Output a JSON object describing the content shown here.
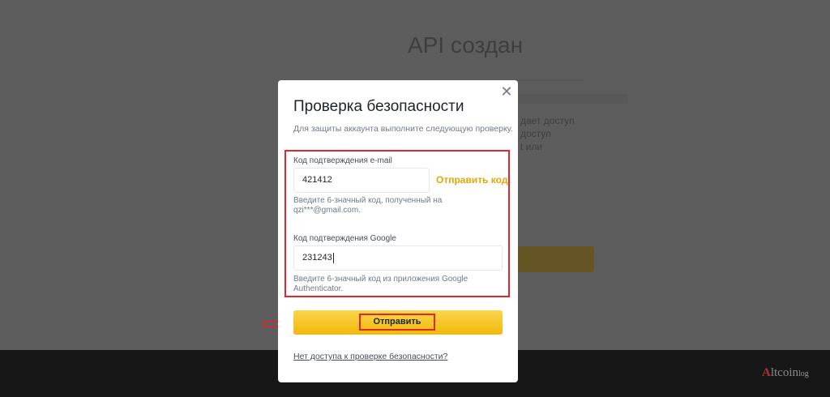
{
  "background": {
    "title": "API создан",
    "text_fragments": [
      "дает доступ",
      "доступ",
      "t или"
    ]
  },
  "modal": {
    "title": "Проверка безопасности",
    "subtitle": "Для защиты аккаунта выполните следующую проверку.",
    "close_icon": "close-icon",
    "email": {
      "label": "Код подтверждения e-mail",
      "value": "421412",
      "send_code_label": "Отправить код",
      "hint": "Введите 6-значный код, полученный на qzi***@gmail.com."
    },
    "google": {
      "label": "Код подтверждения Google",
      "value": "231243",
      "hint": "Введите 6-значный код из приложения Google Authenticator."
    },
    "submit_label": "Отправить",
    "no_access_link": "Нет доступа к проверке безопасности?"
  },
  "watermark": {
    "a": "A",
    "text": "ltcoin",
    "suffix": "log"
  },
  "colors": {
    "accent": "#F0B90B",
    "highlight": "#E0262E",
    "send_code": "#E5A60A"
  }
}
